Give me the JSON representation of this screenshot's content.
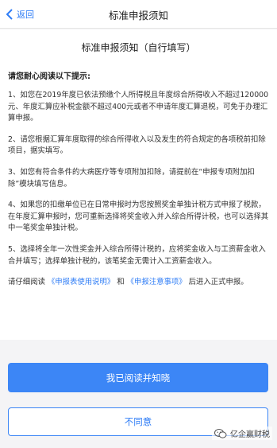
{
  "navbar": {
    "back_label": "返回",
    "title": "标准申报须知"
  },
  "document": {
    "title": "标准申报须知（自行填写）",
    "intro": "请您耐心阅读以下提示:",
    "items": [
      "1、如您在2019年度已依法预缴个人所得税且年度综合所得收入不超过120000元、年度汇算应补税金额不超过400元或者不申请年度汇算退税，可免于办理汇算申报。",
      "2、请您根据汇算年度取得的综合所得收入以及发生的符合规定的各项税前扣除项目，据实填写。",
      "3、如您有符合条件的大病医疗等专项附加扣除，请提前在“申报专项附加扣除”模块填写信息。",
      "4、如果您的扣缴单位已在日常申报时为您按照奖金单独计税方式申报了税款，在年度汇算申报时，您可重新选择将奖金收入并入综合所得计税，也可以选择其中一笔奖金单独计税。",
      "5、选择将全年一次性奖金并入综合所得计税的，应将奖金收入与工资薪金收入合并填写；选择单独计税的，该笔奖金无需计入工资薪金收入。"
    ],
    "footer": {
      "prefix": "请仔细阅读",
      "link1": "《申报表使用说明》",
      "and": "和",
      "link2": "《申报注意事项》",
      "suffix": "后进入正式申报。"
    }
  },
  "buttons": {
    "confirm": "我已阅读并知晓",
    "disagree": "不同意"
  },
  "watermark": {
    "text": "亿企赢财税"
  },
  "colors": {
    "accent": "#3c86f6",
    "link": "#2f7df6"
  }
}
